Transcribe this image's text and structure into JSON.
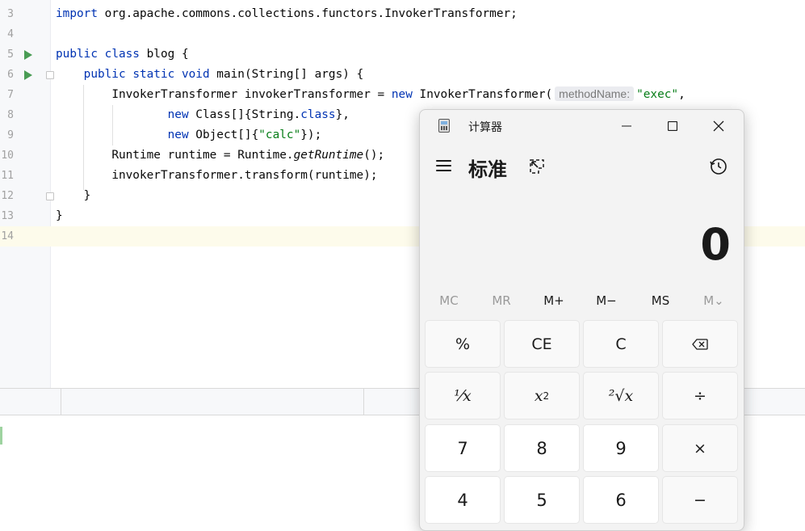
{
  "editor": {
    "lines": [
      {
        "num": "3"
      },
      {
        "num": "4"
      },
      {
        "num": "5"
      },
      {
        "num": "6"
      },
      {
        "num": "7"
      },
      {
        "num": "8"
      },
      {
        "num": "9"
      },
      {
        "num": "10"
      },
      {
        "num": "11"
      },
      {
        "num": "12"
      },
      {
        "num": "13"
      },
      {
        "num": "14"
      }
    ],
    "code": {
      "l3_import": "import",
      "l3_rest": " org.apache.commons.collections.functors.InvokerTransformer;",
      "l5_public": "public",
      "l5_class": "class",
      "l5_rest": " blog {",
      "l6_public": "public",
      "l6_static": "static",
      "l6_void": "void",
      "l6_rest": " main(String[] args) {",
      "l7_a": "InvokerTransformer invokerTransformer = ",
      "l7_new": "new",
      "l7_b": " InvokerTransformer(",
      "l7_hint": "methodName:",
      "l7_str": "\"exec\"",
      "l7_c": ",",
      "l8_new": "new",
      "l8_a": " Class[]{String.",
      "l8_class": "class",
      "l8_b": "},",
      "l9_new": "new",
      "l9_a": " Object[]{",
      "l9_str": "\"calc\"",
      "l9_b": "});",
      "l10_a": "Runtime runtime = Runtime.",
      "l10_ita": "getRuntime",
      "l10_b": "();",
      "l11": "invokerTransformer.transform(runtime);",
      "l12": "}",
      "l13": "}"
    }
  },
  "calculator": {
    "title": "计算器",
    "mode": "标准",
    "display": "0",
    "memory": [
      "MC",
      "MR",
      "M+",
      "M−",
      "MS",
      "M⌄"
    ],
    "keys": {
      "percent": "%",
      "ce": "CE",
      "c": "C",
      "backspace": "⌫",
      "reciprocal": "¹⁄𝑥",
      "square_base": "x",
      "square_exp": "2",
      "sqrt": "²√x",
      "divide": "÷",
      "seven": "7",
      "eight": "8",
      "nine": "9",
      "multiply": "×",
      "four": "4",
      "five": "5",
      "six": "6",
      "minus": "−"
    },
    "icons": [
      "menu-icon",
      "keep-on-top-icon",
      "history-icon",
      "minimize-icon",
      "maximize-icon",
      "close-icon",
      "calculator-app-icon"
    ]
  }
}
